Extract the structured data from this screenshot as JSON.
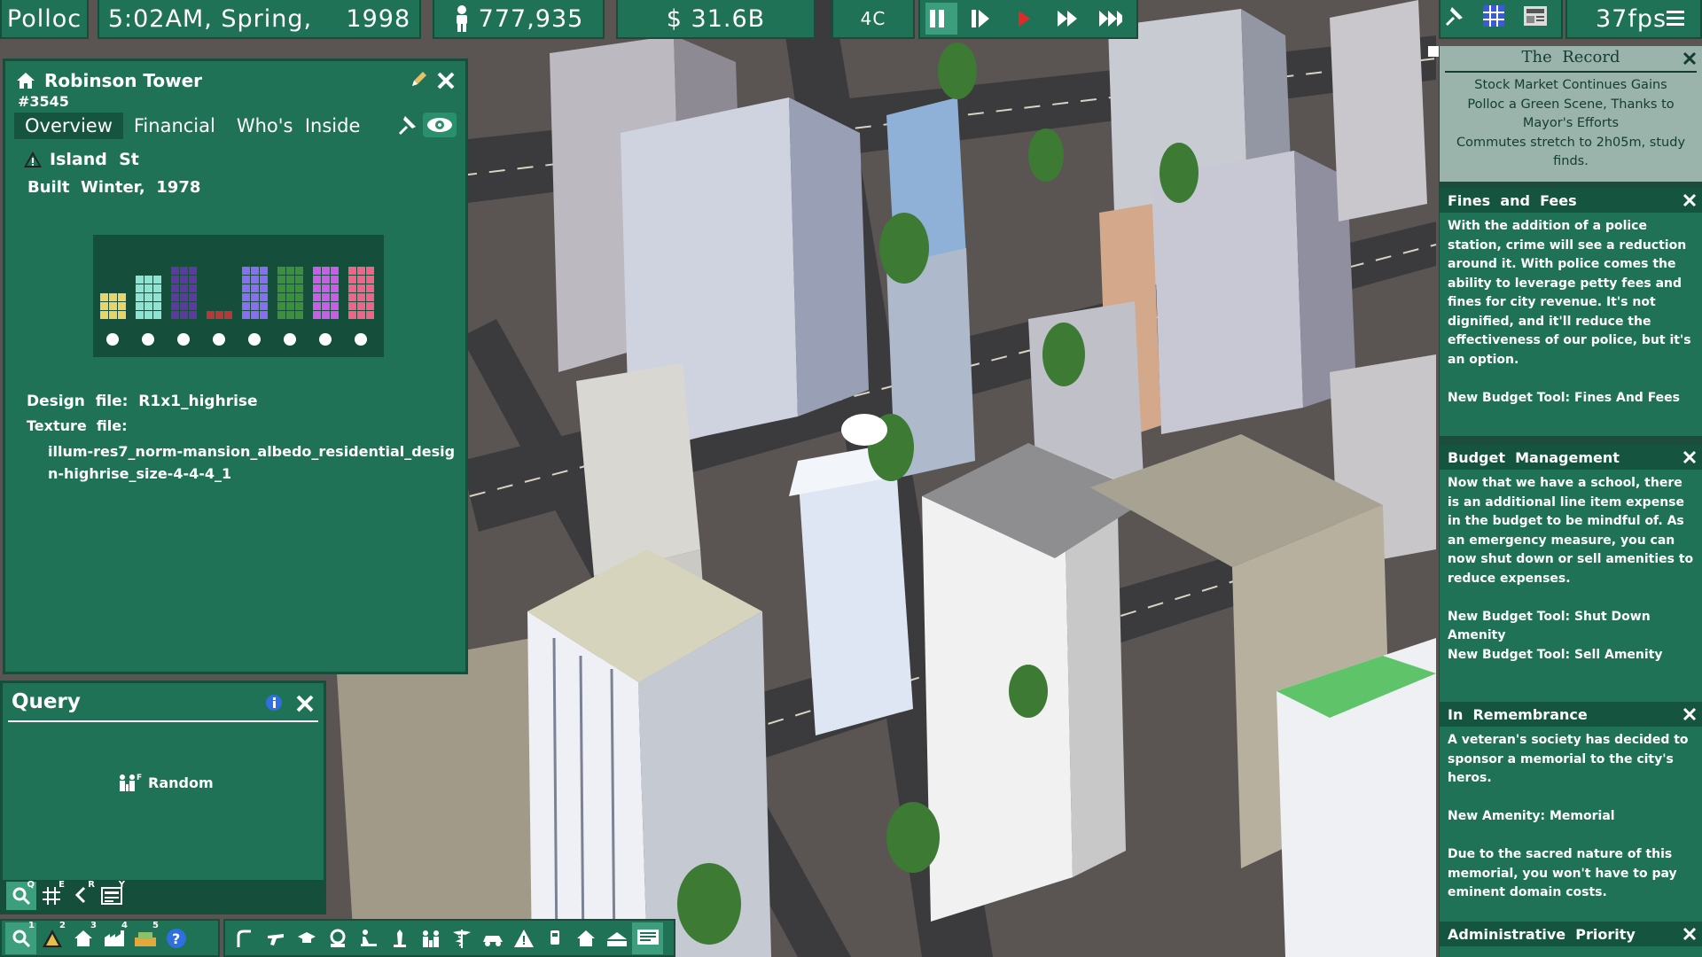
{
  "top_bar": {
    "city_name": "Polloc",
    "datetime": "5:02AM, Spring,    1998",
    "population": "777,935",
    "money": "$ 31.6B",
    "temperature": "4C",
    "fps": "37fps"
  },
  "building_panel": {
    "title": "Robinson Tower",
    "id": "#3545",
    "tabs": [
      "Overview",
      "Financial",
      "Who's  Inside"
    ],
    "active_tab": "Overview",
    "street": "Island  St",
    "built": "Built  Winter,  1978",
    "design_file": "Design  file:  R1x1_highrise",
    "texture_label": "Texture  file:",
    "texture_value": "illum-res7_norm-mansion_albedo_residential_design-highrise_size-4-4-4_1",
    "chart_bars": [
      {
        "icon": "road-icon",
        "color": "#e8d46a",
        "value": 3
      },
      {
        "icon": "park-icon",
        "color": "#8fe3d2",
        "value": 5
      },
      {
        "icon": "monument-icon",
        "color": "#5d3aa0",
        "value": 6
      },
      {
        "icon": "police-icon",
        "color": "#b8383a",
        "value": 1
      },
      {
        "icon": "school-icon",
        "color": "#8a6ef2",
        "value": 6
      },
      {
        "icon": "community-icon",
        "color": "#3c8f3c",
        "value": 6
      },
      {
        "icon": "family-icon",
        "color": "#c85ee8",
        "value": 6
      },
      {
        "icon": "health-icon",
        "color": "#f0648a",
        "value": 6
      }
    ]
  },
  "query_panel": {
    "title": "Query",
    "random_label": "Random",
    "tools": [
      {
        "icon": "search-icon",
        "key": "Q"
      },
      {
        "icon": "grid-icon",
        "key": "E"
      },
      {
        "icon": "route-icon",
        "key": "R"
      },
      {
        "icon": "newspaper-icon",
        "key": "Y"
      }
    ]
  },
  "bottom_bar_left": {
    "buttons": [
      {
        "icon": "search-icon",
        "key": "1"
      },
      {
        "icon": "hazard-icon",
        "key": "2"
      },
      {
        "icon": "house-icon",
        "key": "3"
      },
      {
        "icon": "factory-icon",
        "key": "4"
      },
      {
        "icon": "money-icon",
        "key": "5"
      },
      {
        "icon": "help-icon",
        "key": ""
      }
    ]
  },
  "bottom_bar_right": {
    "buttons": [
      "road-icon",
      "police-icon",
      "school-icon",
      "community-icon",
      "park-icon",
      "monument-icon",
      "family-icon",
      "health-icon",
      "transit-icon",
      "hazard-icon",
      "bus-icon",
      "house-icon",
      "city-icon",
      "chat-icon"
    ]
  },
  "news": {
    "record": {
      "title": "The  Record",
      "lines": [
        "Stock  Market  Continues  Gains",
        "Polloc  a  Green  Scene,  Thanks  to  Mayor's  Efforts",
        "Commutes  stretch  to  2h05m,  study  finds."
      ]
    },
    "cards": [
      {
        "title": "Fines  and  Fees",
        "paragraphs": [
          "With  the  addition  of  a  police  station,  crime  will  see  a  reduction  around  it.  With   police  comes  the  ability  to  leverage  petty  fees  and  fines  for  city  revenue.  It's  not  dignified,  and  it'll  reduce  the  effectiveness  of  our  police,  but  it's  an  option.",
          "New  Budget  Tool:  Fines  And  Fees"
        ]
      },
      {
        "title": "Budget  Management",
        "paragraphs": [
          "Now  that  we  have  a  school,  there  is  an  additional  line  item  expense  in  the  budget  to  be  mindful  of.  As  an  emergency  measure,  you  can  now  shut  down  or  sell  amenities  to  reduce  expenses.",
          "New  Budget  Tool:  Shut  Down  Amenity",
          "New  Budget  Tool:  Sell  Amenity"
        ]
      },
      {
        "title": "In  Remembrance",
        "paragraphs": [
          "A  veteran's  society  has  decided  to  sponsor  a  memorial  to  the  city's  heros.",
          "New  Amenity:  Memorial",
          "Due  to  the  sacred  nature  of  this  memorial,  you  won't  have  to  pay  eminent  domain  costs."
        ]
      },
      {
        "title": "Administrative  Priority",
        "paragraphs": []
      }
    ]
  },
  "colors": {
    "panel": "#1f7256",
    "panel_dark": "#154f3c",
    "record_bg": "#9ab3ab",
    "play_red": "#e02a2a"
  }
}
